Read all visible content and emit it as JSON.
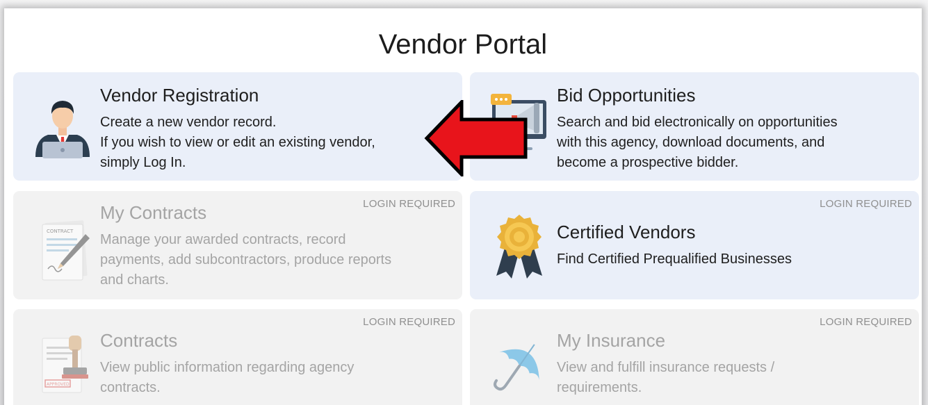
{
  "page": {
    "title": "Vendor Portal"
  },
  "badge_text": "LOGIN REQUIRED",
  "cards": [
    {
      "title": "Vendor Registration",
      "lines": [
        "Create a new vendor record.",
        "If you wish to view or edit an existing vendor,",
        "simply Log In."
      ],
      "icon": "user-avatar-icon",
      "login_required": false
    },
    {
      "title": "Bid Opportunities",
      "lines": [
        "Search and bid electronically on opportunities",
        "with this agency, download documents, and",
        "become a prospective bidder."
      ],
      "icon": "megaphone-monitor-icon",
      "login_required": false
    },
    {
      "title": "My Contracts",
      "lines": [
        "Manage your awarded contracts, record",
        "payments, add subcontractors, produce reports",
        "and charts."
      ],
      "icon": "contract-pen-icon",
      "icon_text": "CONTRACT",
      "login_required": true
    },
    {
      "title": "Certified Vendors",
      "lines": [
        "Find Certified Prequalified Businesses"
      ],
      "icon": "award-medal-icon",
      "login_required": true
    },
    {
      "title": "Contracts",
      "lines": [
        "View public information regarding agency",
        "contracts."
      ],
      "icon": "stamp-document-icon",
      "icon_text": "APPROVED",
      "login_required": true
    },
    {
      "title": "My Insurance",
      "lines": [
        "View and fulfill insurance requests /",
        "requirements."
      ],
      "icon": "umbrella-icon",
      "login_required": true
    }
  ],
  "annotation": {
    "icon": "red-arrow-left-icon",
    "color": "#e8141b"
  },
  "colors": {
    "active_card": "#eaeff9",
    "disabled_card": "#f2f2f2",
    "disabled_text": "#a4a4a4"
  }
}
